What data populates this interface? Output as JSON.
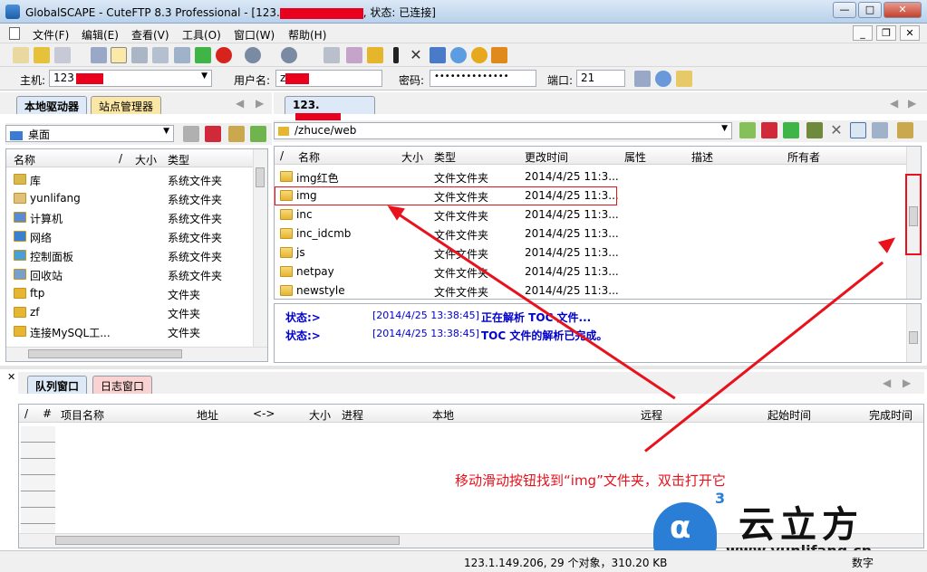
{
  "window": {
    "title": "GlobalSCAPE - CuteFTP 8.3 Professional - [123.",
    "title_suffix": ", 状态: 已连接]"
  },
  "menu": [
    "文件(F)",
    "编辑(E)",
    "查看(V)",
    "工具(O)",
    "窗口(W)",
    "帮助(H)"
  ],
  "connection": {
    "host_label": "主机:",
    "host_value": "123",
    "user_label": "用户名:",
    "user_value": "z",
    "pass_label": "密码:",
    "pass_value": "••••••••••••••",
    "port_label": "端口:",
    "port_value": "21"
  },
  "left": {
    "tab_local": "本地驱动器",
    "tab_site": "站点管理器",
    "location": "桌面",
    "columns": {
      "name": "名称",
      "sep": "/",
      "size": "大小",
      "type": "类型"
    },
    "items": [
      {
        "name": "库",
        "type": "系统文件夹"
      },
      {
        "name": "yunlifang",
        "type": "系统文件夹"
      },
      {
        "name": "计算机",
        "type": "系统文件夹"
      },
      {
        "name": "网络",
        "type": "系统文件夹"
      },
      {
        "name": "控制面板",
        "type": "系统文件夹"
      },
      {
        "name": "回收站",
        "type": "系统文件夹"
      },
      {
        "name": "ftp",
        "type": "文件夹"
      },
      {
        "name": "zf",
        "type": "文件夹"
      },
      {
        "name": "连接MySQL工...",
        "type": "文件夹"
      }
    ]
  },
  "right": {
    "tab": "123.",
    "path": "/zhuce/web",
    "columns": {
      "sep": "/",
      "name": "名称",
      "size": "大小",
      "type": "类型",
      "modified": "更改时间",
      "attr": "属性",
      "desc": "描述",
      "owner": "所有者"
    },
    "items": [
      {
        "name": "img红色",
        "type": "文件文件夹",
        "modified": "2014/4/25 11:3..."
      },
      {
        "name": "img",
        "type": "文件文件夹",
        "modified": "2014/4/25 11:3..."
      },
      {
        "name": "inc",
        "type": "文件文件夹",
        "modified": "2014/4/25 11:3..."
      },
      {
        "name": "inc_idcmb",
        "type": "文件文件夹",
        "modified": "2014/4/25 11:3..."
      },
      {
        "name": "js",
        "type": "文件文件夹",
        "modified": "2014/4/25 11:3..."
      },
      {
        "name": "netpay",
        "type": "文件文件夹",
        "modified": "2014/4/25 11:3..."
      },
      {
        "name": "newstyle",
        "type": "文件文件夹",
        "modified": "2014/4/25 11:3..."
      }
    ]
  },
  "log": [
    {
      "label": "状态:>",
      "time": "[2014/4/25 13:38:45]",
      "msg": "正在解析 TOC 文件..."
    },
    {
      "label": "状态:>",
      "time": "[2014/4/25 13:38:45]",
      "msg": "TOC 文件的解析已完成。"
    }
  ],
  "queue": {
    "tab_queue": "队列窗口",
    "tab_log": "日志窗口",
    "columns": [
      "/",
      "#",
      "项目名称",
      "地址",
      "<->",
      "大小",
      "进程",
      "本地",
      "远程",
      "起始时间",
      "完成时间"
    ]
  },
  "annotation": "移动滑动按钮找到“img”文件夹，双击打开它",
  "brand": {
    "name": "云立方",
    "url": "www.yunlifang.cn",
    "superscript": "3"
  },
  "status": {
    "text": "123.1.149.206, 29 个对象，310.20 KB",
    "mode": "数字"
  },
  "colors": {
    "accent_red": "#e8111c",
    "log_blue": "#0000cc"
  }
}
